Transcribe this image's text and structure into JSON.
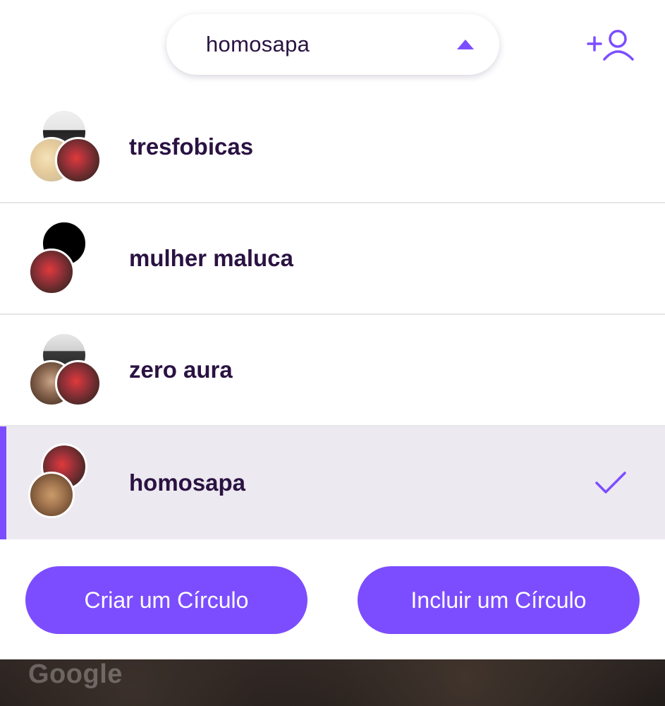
{
  "header": {
    "current_circle": "homosapa",
    "add_member_icon": "add-person-icon",
    "caret_icon": "caret-up-icon"
  },
  "circles": [
    {
      "name": "tresfobicas",
      "selected": false
    },
    {
      "name": "mulher maluca",
      "selected": false
    },
    {
      "name": "zero aura",
      "selected": false
    },
    {
      "name": "homosapa",
      "selected": true
    }
  ],
  "actions": {
    "create_label": "Criar um Círculo",
    "include_label": "Incluir um Círculo"
  },
  "map": {
    "attribution": "Google"
  },
  "colors": {
    "accent": "#7c4dff",
    "text": "#2a1242",
    "selected_row": "#ece9f0"
  }
}
